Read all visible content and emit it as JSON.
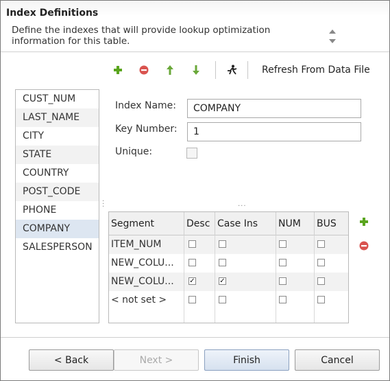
{
  "header": {
    "title": "Index Definitions",
    "description": "Define the indexes that will provide lookup optimization information for this table."
  },
  "toolbar": {
    "icons": [
      "add-icon",
      "remove-icon",
      "move-up-icon",
      "move-down-icon",
      "run-icon"
    ],
    "refresh_label": "Refresh From Data File"
  },
  "fields": [
    "CUST_NUM",
    "LAST_NAME",
    "CITY",
    "STATE",
    "COUNTRY",
    "POST_CODE",
    "PHONE",
    "COMPANY",
    "SALESPERSON"
  ],
  "selected_field": "COMPANY",
  "form": {
    "index_name_label": "Index Name:",
    "index_name_value": "COMPANY",
    "key_number_label": "Key Number:",
    "key_number_value": "1",
    "unique_label": "Unique:",
    "unique_checked": false
  },
  "segments": {
    "columns": [
      "Segment",
      "Desc",
      "Case Ins",
      "NUM",
      "BUS"
    ],
    "rows": [
      {
        "segment": "ITEM_NUM",
        "desc": false,
        "case_ins": false,
        "num": false,
        "bus": false
      },
      {
        "segment": "NEW_COLU...",
        "desc": false,
        "case_ins": false,
        "num": false,
        "bus": false
      },
      {
        "segment": "NEW_COLU...",
        "desc": true,
        "case_ins": true,
        "num": false,
        "bus": false
      },
      {
        "segment": "< not set >",
        "desc": false,
        "case_ins": false,
        "num": false,
        "bus": false
      }
    ]
  },
  "buttons": {
    "back": "< Back",
    "next": "Next >",
    "finish": "Finish",
    "cancel": "Cancel"
  },
  "colors": {
    "add": "#5aa51e",
    "remove": "#d9534f",
    "arrow": "#6aa83a",
    "selected_row": "#dde6f1"
  }
}
